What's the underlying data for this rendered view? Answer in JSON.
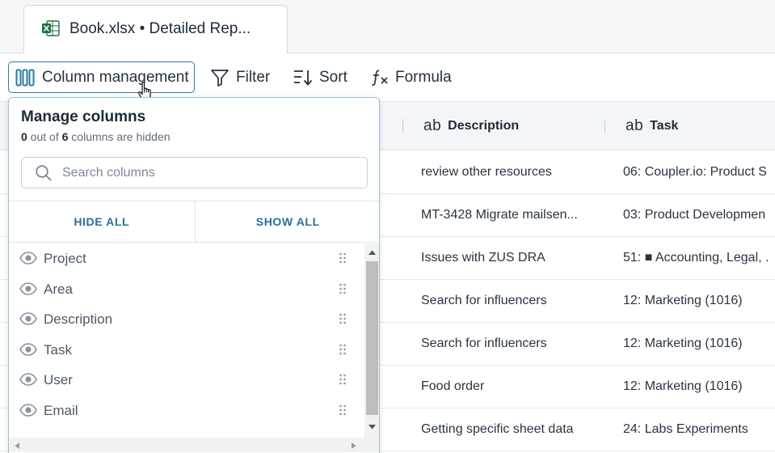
{
  "tab": {
    "title": "Book.xlsx • Detailed Rep...",
    "icon": "excel-icon",
    "icon_color": "#1d7044"
  },
  "toolbar": {
    "column_management": "Column management",
    "filter": "Filter",
    "sort": "Sort",
    "formula": "Formula",
    "accent": "#2a7aa8"
  },
  "grid": {
    "columns": [
      {
        "type_icon": "ab",
        "label": "Description"
      },
      {
        "type_icon": "ab",
        "label": "Task"
      }
    ],
    "rows": [
      {
        "description": "review other resources",
        "task": "06: Coupler.io: Product S"
      },
      {
        "description": "MT-3428 Migrate mailsen...",
        "task": "03: Product Developmen"
      },
      {
        "description": "Issues with ZUS DRA",
        "task": "51: ■ Accounting, Legal, ."
      },
      {
        "description": "Search for influencers",
        "task": "12: Marketing (1016)"
      },
      {
        "description": "Search for influencers",
        "task": "12: Marketing (1016)"
      },
      {
        "description": "Food order",
        "task": "12: Marketing (1016)"
      },
      {
        "description": "Getting specific sheet data",
        "task": "24: Labs Experiments"
      }
    ]
  },
  "panel": {
    "title": "Manage columns",
    "hidden_count": "0",
    "total_count": "6",
    "out_of_text": " out of ",
    "hidden_text": " columns are hidden",
    "search_placeholder": "Search columns",
    "search_value": "",
    "hide_all": "HIDE ALL",
    "show_all": "SHOW ALL",
    "columns": [
      "Project",
      "Area",
      "Description",
      "Task",
      "User",
      "Email"
    ]
  }
}
